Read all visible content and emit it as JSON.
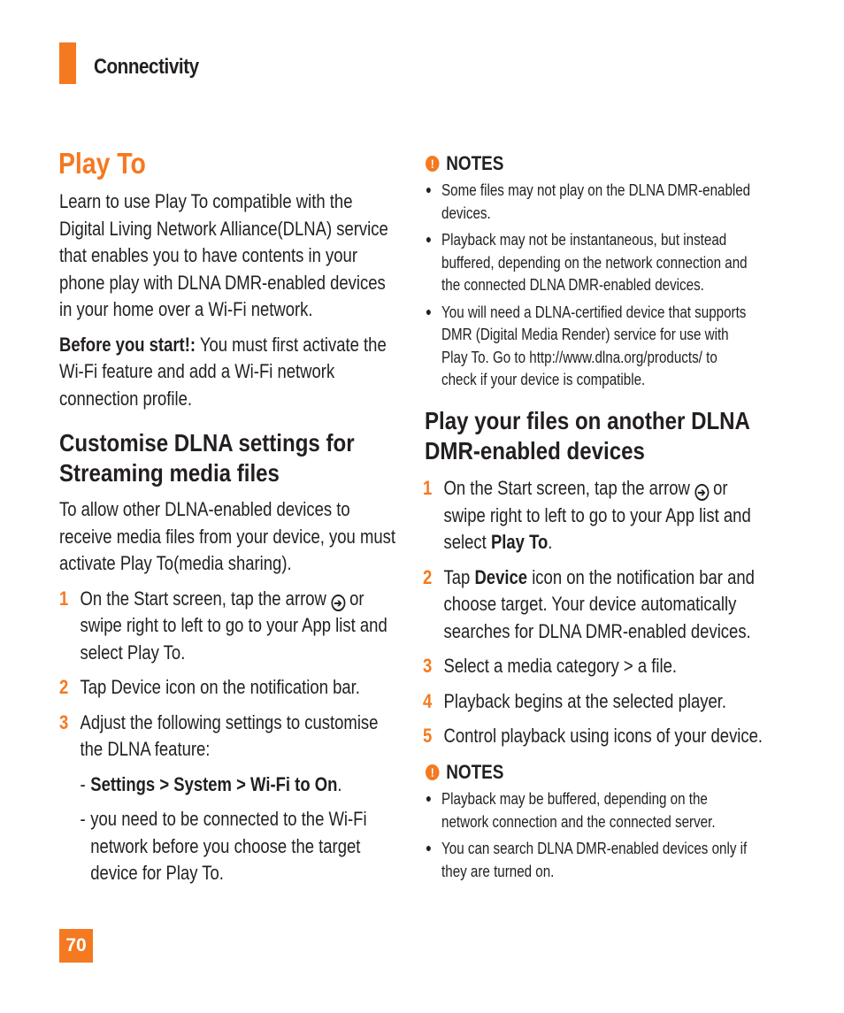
{
  "header": {
    "section": "Connectivity",
    "accent": "#f47920"
  },
  "title": "Play To",
  "left": {
    "intro": "Learn to use Play To compatible with the Digital Living Network Alliance(DLNA) service that enables you to have contents in your phone play with DLNA DMR-enabled devices in your home over a Wi-Fi network.",
    "before_label": "Before you start!:",
    "before_text": " You must first activate the Wi-Fi feature and add a Wi-Fi network connection profile.",
    "heading": "Customise DLNA settings for Streaming media files",
    "para": "To allow other DLNA-enabled devices to receive media files from your device, you must activate Play To(media sharing).",
    "steps": [
      {
        "num": "1",
        "pre": "On the Start screen, tap the arrow ",
        "post": " or swipe right to left to go to your App list and select Play To."
      },
      {
        "num": "2",
        "text": "Tap Device icon on the notification bar."
      },
      {
        "num": "3",
        "text": "Adjust the following settings to customise the DLNA feature:"
      }
    ],
    "subs": [
      {
        "dash": "-",
        "bold": "Settings > System > Wi-Fi  to On",
        "text": "."
      },
      {
        "dash": "-",
        "text": "you need to be connected to the Wi-Fi network before you choose the target device for Play To."
      }
    ]
  },
  "right": {
    "notes1_label": "NOTES",
    "notes1": [
      "Some files may not play on the DLNA DMR-enabled devices.",
      "Playback may not be instantaneous, but instead buffered, depending on the network connection and the connected DLNA DMR-enabled devices.",
      "You will need a DLNA-certified device that supports DMR (Digital Media Render) service for use with Play To. Go to http://www.dlna.org/products/ to check if your device is compatible."
    ],
    "heading": "Play your files on another DLNA DMR-enabled devices",
    "steps": [
      {
        "num": "1",
        "pre": "On the Start screen, tap the arrow ",
        "post": " or swipe right to left to go to your App list and select ",
        "bold": "Play To",
        "end": "."
      },
      {
        "num": "2",
        "pre": "Tap ",
        "bold": "Device",
        "post": " icon on the notification bar and choose target. Your device automatically searches for DLNA DMR-enabled devices."
      },
      {
        "num": "3",
        "text": "Select a media category > a file."
      },
      {
        "num": "4",
        "text": "Playback begins at the selected player."
      },
      {
        "num": "5",
        "text": "Control playback using icons of your device."
      }
    ],
    "notes2_label": "NOTES",
    "notes2": [
      "Playback may be buffered, depending on the network connection and the connected server.",
      "You can search DLNA DMR-enabled devices only if they are turned on."
    ]
  },
  "icons": {
    "arrow": "➔",
    "warn": "!",
    "bullet": "●"
  },
  "page_number": "70"
}
